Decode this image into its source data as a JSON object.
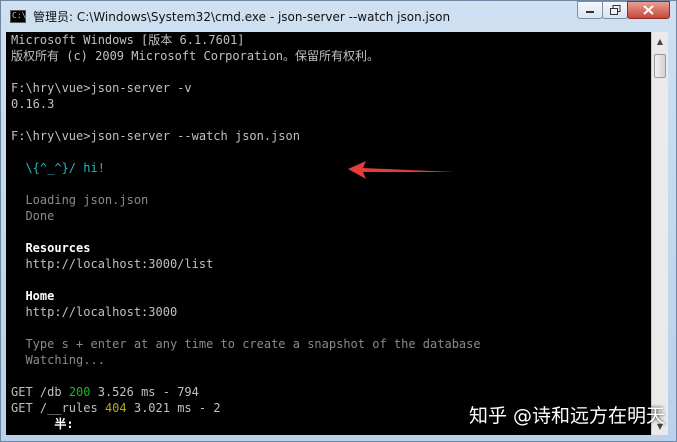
{
  "window": {
    "title": "管理员: C:\\Windows\\System32\\cmd.exe - json-server  --watch json.json",
    "app_icon_text": "C:\\"
  },
  "controls": [
    "minimize-icon",
    "restore-icon",
    "close-icon"
  ],
  "console": {
    "lines": [
      {
        "t": "Microsoft Windows [版本 6.1.7601]",
        "c": "plain"
      },
      {
        "t": "版权所有 (c) 2009 Microsoft Corporation。保留所有权利。",
        "c": "plain"
      },
      {
        "t": "",
        "c": "plain"
      },
      {
        "t": "F:\\hry\\vue>json-server -v",
        "c": "plain"
      },
      {
        "t": "0.16.3",
        "c": "plain"
      },
      {
        "t": "",
        "c": "plain"
      },
      {
        "t": "F:\\hry\\vue>json-server --watch json.json",
        "c": "plain"
      },
      {
        "t": "",
        "c": "plain"
      },
      {
        "t": "  \\{^_^}/ hi!",
        "c": "cyan"
      },
      {
        "t": "",
        "c": "plain"
      },
      {
        "t": "  Loading json.json",
        "c": "gray"
      },
      {
        "t": "  Done",
        "c": "gray"
      },
      {
        "t": "",
        "c": "plain"
      },
      {
        "t": "  Resources",
        "c": "bold"
      },
      {
        "t": "  http://localhost:3000/list",
        "c": "plain"
      },
      {
        "t": "",
        "c": "plain"
      },
      {
        "t": "  Home",
        "c": "bold"
      },
      {
        "t": "  http://localhost:3000",
        "c": "plain"
      },
      {
        "t": "",
        "c": "plain"
      },
      {
        "t": "  Type s + enter at any time to create a snapshot of the database",
        "c": "gray"
      },
      {
        "t": "  Watching...",
        "c": "gray"
      },
      {
        "t": "",
        "c": "plain"
      }
    ],
    "requests": [
      {
        "method": "GET",
        "path": "/db",
        "status": "200",
        "status_color": "green",
        "time": "3.526 ms - 794"
      },
      {
        "method": "GET",
        "path": "/__rules",
        "status": "404",
        "status_color": "yellow",
        "time": "3.021 ms - 2"
      }
    ],
    "ime_line": "      半:"
  },
  "watermark": "知乎 @诗和远方在明天",
  "colors": {
    "arrow": "#e43b3b",
    "console_bg": "#000000"
  }
}
